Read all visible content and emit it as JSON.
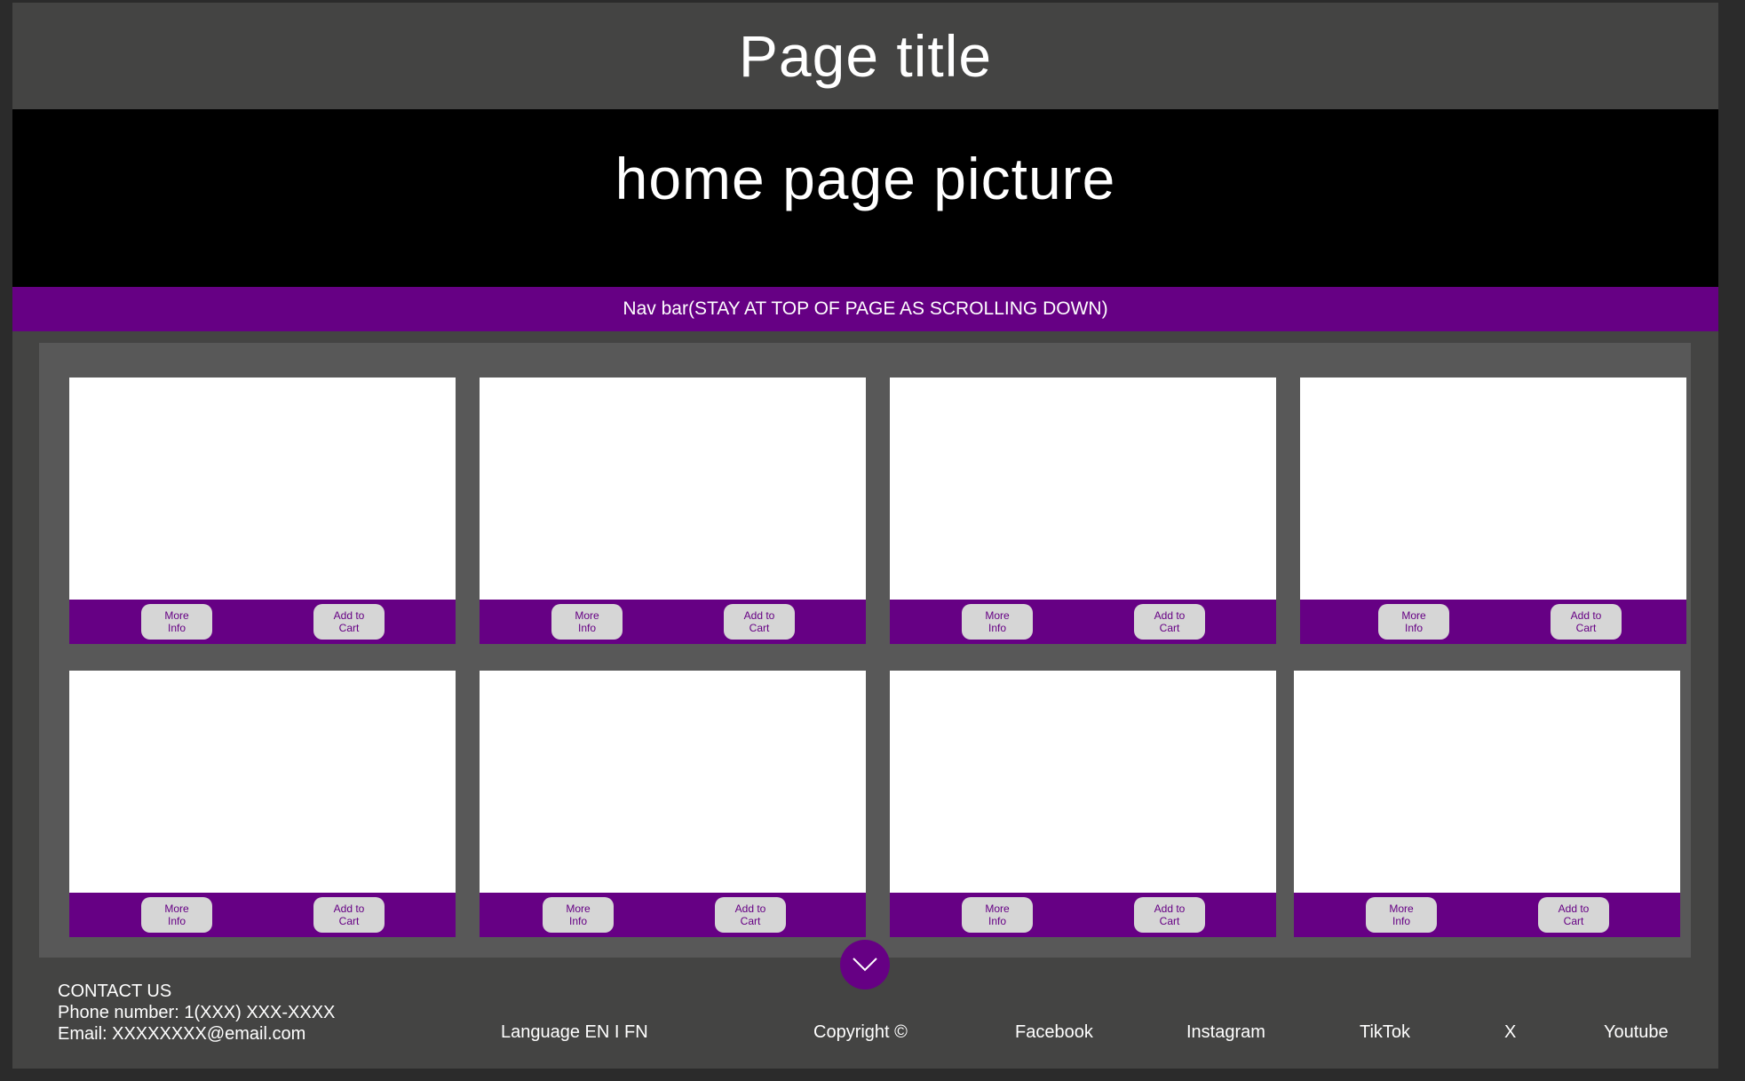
{
  "header": {
    "title": "Page title"
  },
  "hero": {
    "label": "home page picture"
  },
  "navbar": {
    "label": "Nav bar(STAY AT TOP OF PAGE AS SCROLLING DOWN)"
  },
  "products": {
    "more_info_label": "More\nInfo",
    "add_to_cart_label": "Add to\nCart",
    "count": 8
  },
  "scroll": {
    "icon": "chevron-down-icon"
  },
  "footer": {
    "contact_heading": "CONTACT US",
    "phone": "Phone number: 1(XXX) XXX-XXXX",
    "email": "Email: XXXXXXXX@email.com",
    "language": "Language EN I FN",
    "copyright": "Copyright ©",
    "social": [
      "Facebook",
      "Instagram",
      "TikTok",
      "X",
      "Youtube"
    ]
  },
  "colors": {
    "accent_purple": "#660084",
    "header_bg": "#444443",
    "panel_bg": "#585858",
    "button_bg": "#d6d6d6"
  }
}
